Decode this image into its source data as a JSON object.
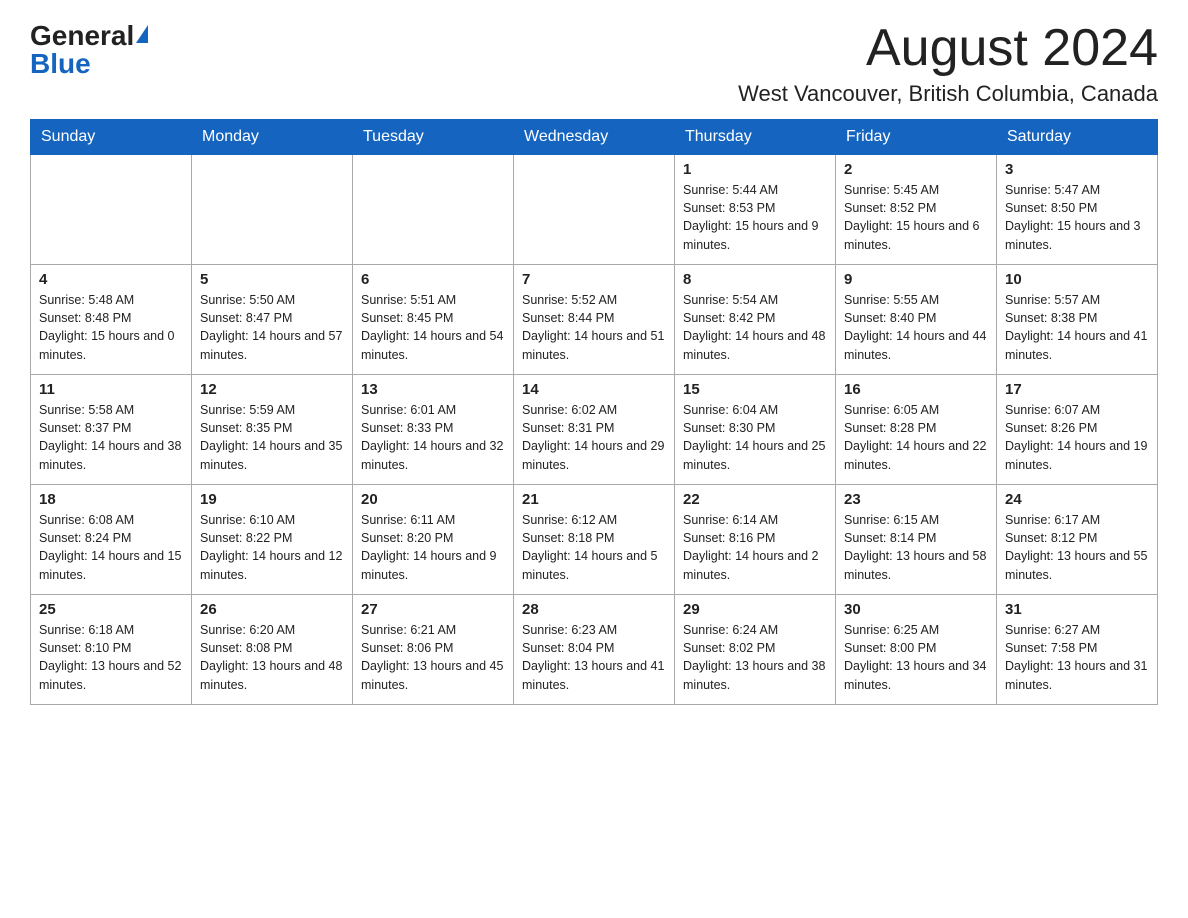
{
  "header": {
    "logo_general": "General",
    "logo_blue": "Blue",
    "month_year": "August 2024",
    "location": "West Vancouver, British Columbia, Canada"
  },
  "calendar": {
    "days_of_week": [
      "Sunday",
      "Monday",
      "Tuesday",
      "Wednesday",
      "Thursday",
      "Friday",
      "Saturday"
    ],
    "weeks": [
      [
        {
          "day": "",
          "info": ""
        },
        {
          "day": "",
          "info": ""
        },
        {
          "day": "",
          "info": ""
        },
        {
          "day": "",
          "info": ""
        },
        {
          "day": "1",
          "info": "Sunrise: 5:44 AM\nSunset: 8:53 PM\nDaylight: 15 hours and 9 minutes."
        },
        {
          "day": "2",
          "info": "Sunrise: 5:45 AM\nSunset: 8:52 PM\nDaylight: 15 hours and 6 minutes."
        },
        {
          "day": "3",
          "info": "Sunrise: 5:47 AM\nSunset: 8:50 PM\nDaylight: 15 hours and 3 minutes."
        }
      ],
      [
        {
          "day": "4",
          "info": "Sunrise: 5:48 AM\nSunset: 8:48 PM\nDaylight: 15 hours and 0 minutes."
        },
        {
          "day": "5",
          "info": "Sunrise: 5:50 AM\nSunset: 8:47 PM\nDaylight: 14 hours and 57 minutes."
        },
        {
          "day": "6",
          "info": "Sunrise: 5:51 AM\nSunset: 8:45 PM\nDaylight: 14 hours and 54 minutes."
        },
        {
          "day": "7",
          "info": "Sunrise: 5:52 AM\nSunset: 8:44 PM\nDaylight: 14 hours and 51 minutes."
        },
        {
          "day": "8",
          "info": "Sunrise: 5:54 AM\nSunset: 8:42 PM\nDaylight: 14 hours and 48 minutes."
        },
        {
          "day": "9",
          "info": "Sunrise: 5:55 AM\nSunset: 8:40 PM\nDaylight: 14 hours and 44 minutes."
        },
        {
          "day": "10",
          "info": "Sunrise: 5:57 AM\nSunset: 8:38 PM\nDaylight: 14 hours and 41 minutes."
        }
      ],
      [
        {
          "day": "11",
          "info": "Sunrise: 5:58 AM\nSunset: 8:37 PM\nDaylight: 14 hours and 38 minutes."
        },
        {
          "day": "12",
          "info": "Sunrise: 5:59 AM\nSunset: 8:35 PM\nDaylight: 14 hours and 35 minutes."
        },
        {
          "day": "13",
          "info": "Sunrise: 6:01 AM\nSunset: 8:33 PM\nDaylight: 14 hours and 32 minutes."
        },
        {
          "day": "14",
          "info": "Sunrise: 6:02 AM\nSunset: 8:31 PM\nDaylight: 14 hours and 29 minutes."
        },
        {
          "day": "15",
          "info": "Sunrise: 6:04 AM\nSunset: 8:30 PM\nDaylight: 14 hours and 25 minutes."
        },
        {
          "day": "16",
          "info": "Sunrise: 6:05 AM\nSunset: 8:28 PM\nDaylight: 14 hours and 22 minutes."
        },
        {
          "day": "17",
          "info": "Sunrise: 6:07 AM\nSunset: 8:26 PM\nDaylight: 14 hours and 19 minutes."
        }
      ],
      [
        {
          "day": "18",
          "info": "Sunrise: 6:08 AM\nSunset: 8:24 PM\nDaylight: 14 hours and 15 minutes."
        },
        {
          "day": "19",
          "info": "Sunrise: 6:10 AM\nSunset: 8:22 PM\nDaylight: 14 hours and 12 minutes."
        },
        {
          "day": "20",
          "info": "Sunrise: 6:11 AM\nSunset: 8:20 PM\nDaylight: 14 hours and 9 minutes."
        },
        {
          "day": "21",
          "info": "Sunrise: 6:12 AM\nSunset: 8:18 PM\nDaylight: 14 hours and 5 minutes."
        },
        {
          "day": "22",
          "info": "Sunrise: 6:14 AM\nSunset: 8:16 PM\nDaylight: 14 hours and 2 minutes."
        },
        {
          "day": "23",
          "info": "Sunrise: 6:15 AM\nSunset: 8:14 PM\nDaylight: 13 hours and 58 minutes."
        },
        {
          "day": "24",
          "info": "Sunrise: 6:17 AM\nSunset: 8:12 PM\nDaylight: 13 hours and 55 minutes."
        }
      ],
      [
        {
          "day": "25",
          "info": "Sunrise: 6:18 AM\nSunset: 8:10 PM\nDaylight: 13 hours and 52 minutes."
        },
        {
          "day": "26",
          "info": "Sunrise: 6:20 AM\nSunset: 8:08 PM\nDaylight: 13 hours and 48 minutes."
        },
        {
          "day": "27",
          "info": "Sunrise: 6:21 AM\nSunset: 8:06 PM\nDaylight: 13 hours and 45 minutes."
        },
        {
          "day": "28",
          "info": "Sunrise: 6:23 AM\nSunset: 8:04 PM\nDaylight: 13 hours and 41 minutes."
        },
        {
          "day": "29",
          "info": "Sunrise: 6:24 AM\nSunset: 8:02 PM\nDaylight: 13 hours and 38 minutes."
        },
        {
          "day": "30",
          "info": "Sunrise: 6:25 AM\nSunset: 8:00 PM\nDaylight: 13 hours and 34 minutes."
        },
        {
          "day": "31",
          "info": "Sunrise: 6:27 AM\nSunset: 7:58 PM\nDaylight: 13 hours and 31 minutes."
        }
      ]
    ]
  }
}
